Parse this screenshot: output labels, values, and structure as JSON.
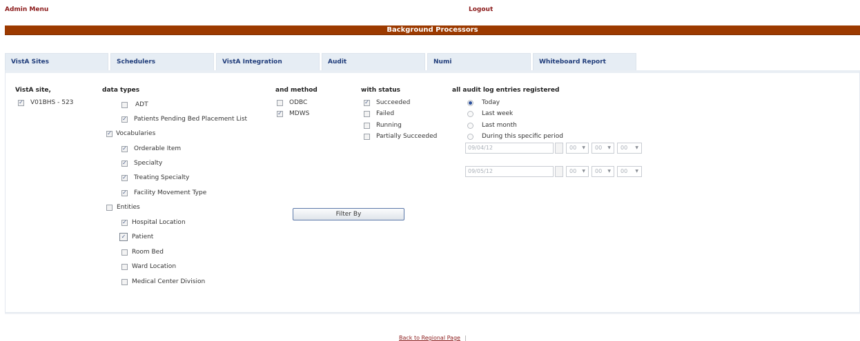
{
  "header": {
    "admin_menu": "Admin Menu",
    "logout": "Logout",
    "title": "Background Processors"
  },
  "tabs": [
    "VistA Sites",
    "Schedulers",
    "VistA Integration",
    "Audit",
    "Numi",
    "Whiteboard Report"
  ],
  "vista_site": {
    "heading": "VistA site,",
    "item": {
      "label": "V01BHS - 523",
      "checked": true
    }
  },
  "data_types": {
    "heading": "data types",
    "adt": {
      "label": "ADT",
      "checked": false
    },
    "pending": {
      "label": "Patients Pending Bed Placement List",
      "checked": true
    },
    "vocabularies": {
      "label": "Vocabularies",
      "checked": true,
      "items": [
        {
          "label": "Orderable Item",
          "checked": true
        },
        {
          "label": "Specialty",
          "checked": true
        },
        {
          "label": "Treating Specialty",
          "checked": true
        },
        {
          "label": "Facility Movement Type",
          "checked": true
        }
      ]
    },
    "entities": {
      "label": "Entities",
      "checked": false,
      "items": [
        {
          "label": "Hospital Location",
          "checked": true
        },
        {
          "label": "Patient",
          "checked": true
        },
        {
          "label": "Room Bed",
          "checked": false
        },
        {
          "label": "Ward Location",
          "checked": false
        },
        {
          "label": "Medical Center Division",
          "checked": false
        }
      ]
    }
  },
  "method": {
    "heading": "and method",
    "items": [
      {
        "label": "ODBC",
        "checked": false
      },
      {
        "label": "MDWS",
        "checked": true
      }
    ]
  },
  "status": {
    "heading": "with status",
    "items": [
      {
        "label": "Succeeded",
        "checked": true
      },
      {
        "label": "Failed",
        "checked": false
      },
      {
        "label": "Running",
        "checked": false
      },
      {
        "label": "Partially Succeeded",
        "checked": false
      }
    ]
  },
  "audit_log": {
    "heading": "all audit log entries registered",
    "options": [
      "Today",
      "Last week",
      "Last month",
      "During this specific period"
    ],
    "selected": "Today",
    "from": {
      "date": "09/04/12",
      "hour": "00",
      "minute": "00",
      "second": "00"
    },
    "to": {
      "date": "09/05/12",
      "hour": "00",
      "minute": "00",
      "second": "00"
    }
  },
  "filter_button": "Filter By",
  "footer": {
    "link": "Back to Regional Page",
    "separator": "|"
  },
  "icons": {
    "checkbox_checked": "checkmark-icon",
    "select_arrow": "chevron-down-icon"
  },
  "colors": {
    "title_bar": "#9c3a00",
    "link": "#8b1a1a",
    "tab_bg": "#e6edf4",
    "tab_text": "#1f3c7a"
  }
}
